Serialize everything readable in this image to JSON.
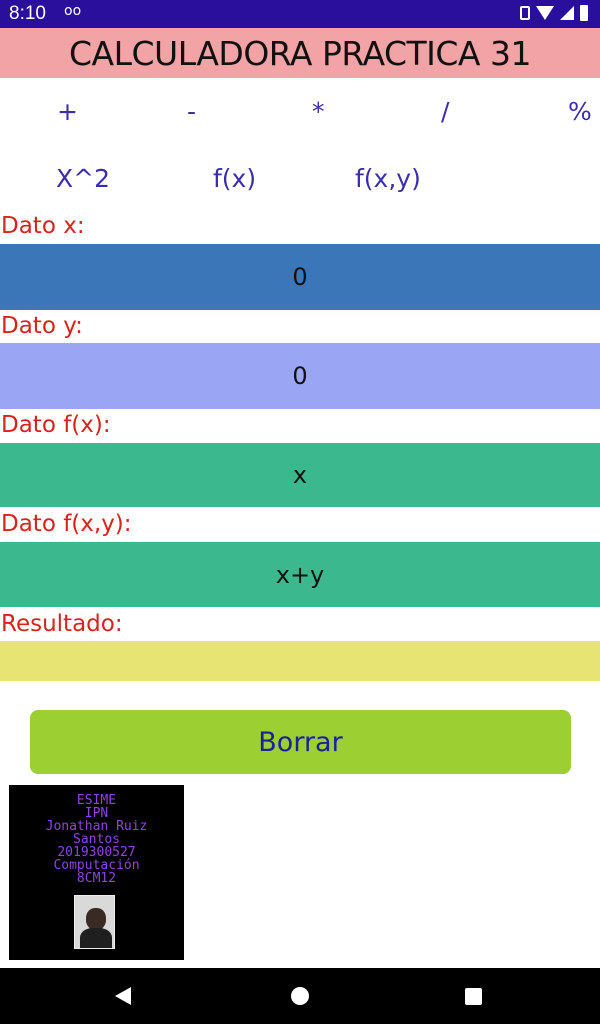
{
  "status_bar": {
    "time": "8:10",
    "voicemail": "oo",
    "icons": [
      "vibrate-icon",
      "wifi-icon",
      "signal-icon",
      "battery-icon"
    ]
  },
  "header": {
    "title": "CALCULADORA PRACTICA 31",
    "background": "#f2a3a6"
  },
  "operations": {
    "add": "+",
    "subtract": "-",
    "multiply": "*",
    "divide": "/",
    "percent": "%",
    "square": "X^2",
    "fx": "f(x)",
    "fxy": "f(x,y)"
  },
  "fields": {
    "x": {
      "label": "Dato x:",
      "value": "0",
      "color": "#3b76b8"
    },
    "y": {
      "label": "Dato y:",
      "value": "0",
      "color": "#9aa6f4"
    },
    "fx": {
      "label": "Dato f(x):",
      "value": "x",
      "color": "#3cb88f"
    },
    "fxy": {
      "label": "Dato f(x,y):",
      "value": "x+y",
      "color": "#3cb88f"
    },
    "result": {
      "label": "Resultado:",
      "value": "",
      "color": "#e7e474"
    }
  },
  "clear_button": {
    "label": "Borrar",
    "color": "#9bcf32"
  },
  "info_card": {
    "lines": [
      "ESIME",
      "IPN",
      "Jonathan Ruiz",
      "Santos",
      "2019300527",
      "Computación",
      "8CM12"
    ]
  },
  "nav_bar": {
    "icons": [
      "back-icon",
      "home-icon",
      "recents-icon"
    ]
  }
}
